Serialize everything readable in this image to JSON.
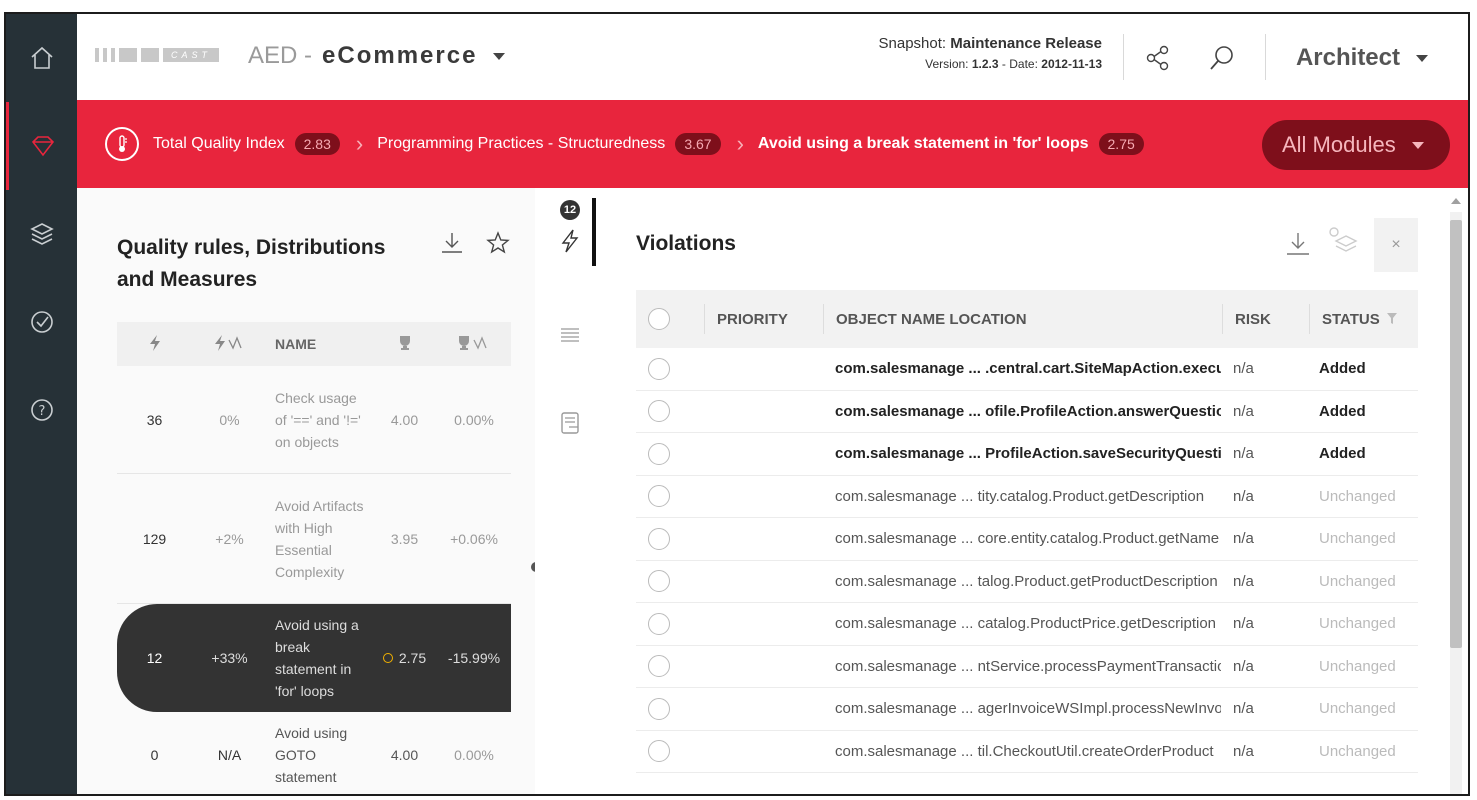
{
  "header": {
    "logo_text": "CAST",
    "app_prefix": "AED -",
    "app_name": "eCommerce",
    "snapshot_label": "Snapshot:",
    "snapshot_name": "Maintenance Release",
    "version_label": "Version:",
    "version": "1.2.3",
    "date_label": "- Date:",
    "date": "2012-11-13",
    "role": "Architect"
  },
  "breadcrumb": {
    "items": [
      {
        "label": "Total Quality Index",
        "value": "2.83"
      },
      {
        "label": "Programming Practices - Structuredness",
        "value": "3.67"
      },
      {
        "label": "Avoid using a break statement in 'for' loops",
        "value": "2.75"
      }
    ],
    "modules_label": "All Modules"
  },
  "left_panel": {
    "title": "Quality rules, Distributions and Measures",
    "columns": {
      "name": "NAME"
    },
    "rows": [
      {
        "count": "36",
        "trend": "0%",
        "name": "Check usage of '==' and '!=' on objects",
        "grade": "4.00",
        "grade_trend": "0.00%"
      },
      {
        "count": "129",
        "trend": "+2%",
        "name": "Avoid Artifacts with High Essential Complexity",
        "grade": "3.95",
        "grade_trend": "+0.06%"
      },
      {
        "count": "12",
        "trend": "+33%",
        "name": "Avoid using a break statement in 'for' loops",
        "grade": "2.75",
        "grade_trend": "-15.99%"
      },
      {
        "count": "0",
        "trend": "N/A",
        "name": "Avoid using GOTO statement",
        "grade": "4.00",
        "grade_trend": "0.00%"
      }
    ]
  },
  "middle": {
    "badge_count": "12"
  },
  "violations": {
    "title": "Violations",
    "close_label": "×",
    "columns": {
      "priority": "PRIORITY",
      "object": "OBJECT NAME LOCATION",
      "risk": "RISK",
      "status": "STATUS"
    },
    "rows": [
      {
        "object": "com.salesmanage ... .central.cart.SiteMapAction.execute",
        "risk": "n/a",
        "status": "Added"
      },
      {
        "object": "com.salesmanage ... ofile.ProfileAction.answerQuestions",
        "risk": "n/a",
        "status": "Added"
      },
      {
        "object": "com.salesmanage ... ProfileAction.saveSecurityQuestions",
        "risk": "n/a",
        "status": "Added"
      },
      {
        "object": "com.salesmanage ... tity.catalog.Product.getDescription",
        "risk": "n/a",
        "status": "Unchanged"
      },
      {
        "object": "com.salesmanage ... core.entity.catalog.Product.getName",
        "risk": "n/a",
        "status": "Unchanged"
      },
      {
        "object": "com.salesmanage ... talog.Product.getProductDescription",
        "risk": "n/a",
        "status": "Unchanged"
      },
      {
        "object": "com.salesmanage ... catalog.ProductPrice.getDescription",
        "risk": "n/a",
        "status": "Unchanged"
      },
      {
        "object": "com.salesmanage ... ntService.processPaymentTransaction",
        "risk": "n/a",
        "status": "Unchanged"
      },
      {
        "object": "com.salesmanage ... agerInvoiceWSImpl.processNewInvoice",
        "risk": "n/a",
        "status": "Unchanged"
      },
      {
        "object": "com.salesmanage ... til.CheckoutUtil.createOrderProduct",
        "risk": "n/a",
        "status": "Unchanged"
      }
    ]
  },
  "colors": {
    "accent": "#e8253d",
    "accent_dark": "#7e0f1b",
    "rail": "#263137"
  }
}
